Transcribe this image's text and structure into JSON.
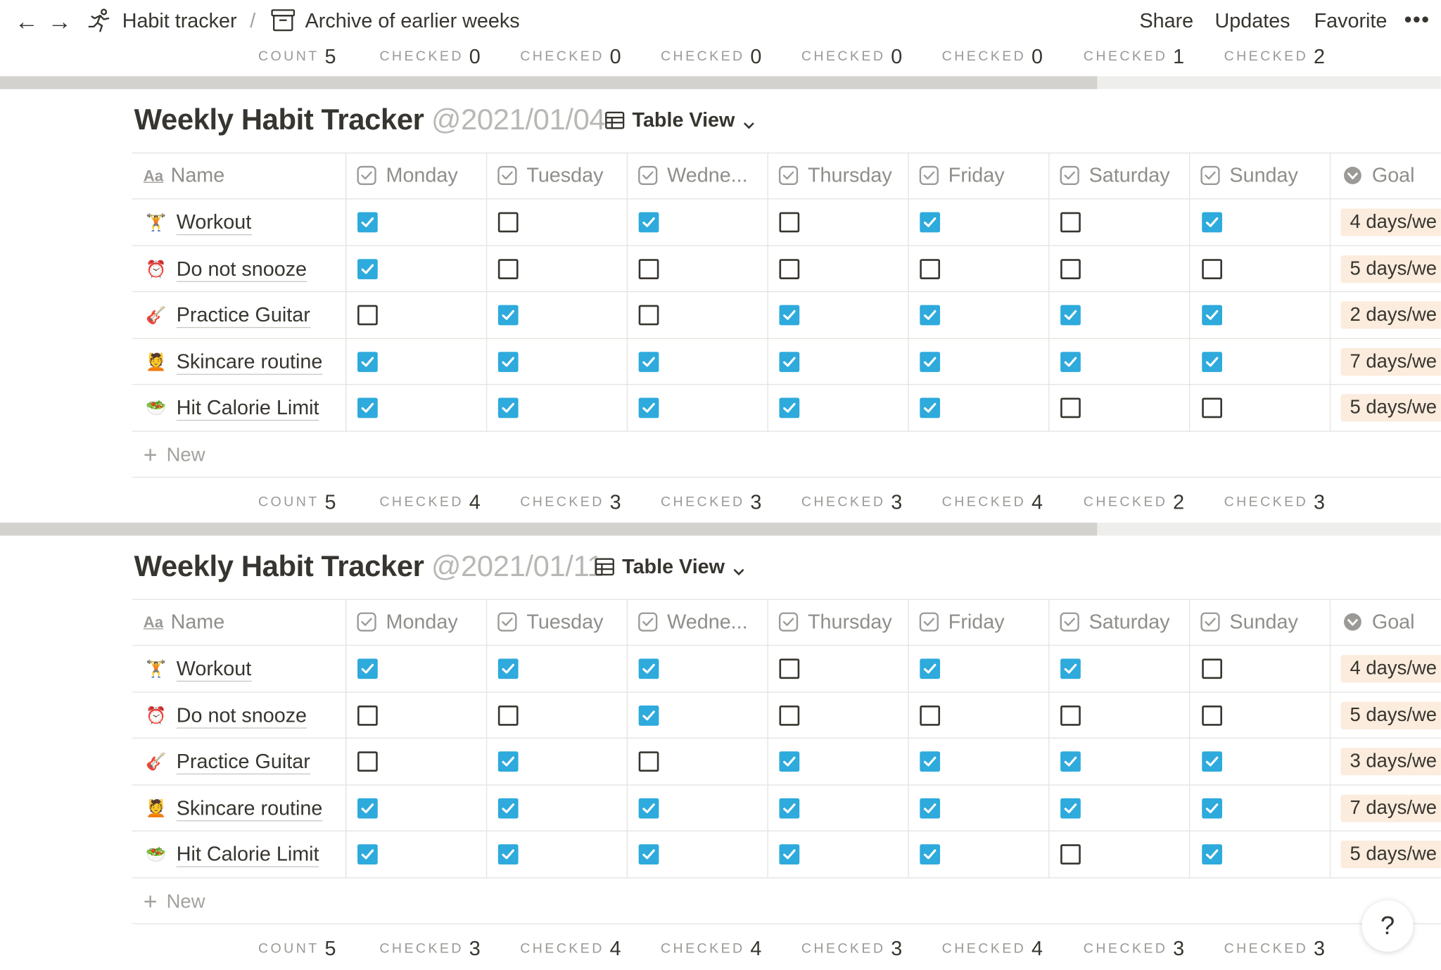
{
  "breadcrumb": {
    "parent": "Habit tracker",
    "separator": "/",
    "current": "Archive of earlier weeks"
  },
  "topbar": {
    "share": "Share",
    "updates": "Updates",
    "favorite": "Favorite",
    "more": "•••"
  },
  "summary_top": {
    "cells": [
      {
        "label": "COUNT",
        "value": "5"
      },
      {
        "label": "CHECKED",
        "value": "0"
      },
      {
        "label": "CHECKED",
        "value": "0"
      },
      {
        "label": "CHECKED",
        "value": "0"
      },
      {
        "label": "CHECKED",
        "value": "0"
      },
      {
        "label": "CHECKED",
        "value": "0"
      },
      {
        "label": "CHECKED",
        "value": "1"
      },
      {
        "label": "CHECKED",
        "value": "2"
      }
    ]
  },
  "columns": {
    "name": "Name",
    "days": [
      "Monday",
      "Tuesday",
      "Wedne...",
      "Thursday",
      "Friday",
      "Saturday",
      "Sunday"
    ],
    "goal": "Goal"
  },
  "trackers": [
    {
      "title": "Weekly Habit Tracker",
      "date": "@2021/01/04",
      "view": "Table View",
      "new_label": "New",
      "rows": [
        {
          "emoji": "🏋",
          "name": "Workout",
          "checks": [
            true,
            false,
            true,
            false,
            true,
            false,
            true
          ],
          "goal": "4 days/we"
        },
        {
          "emoji": "⏰",
          "name": "Do not snooze",
          "checks": [
            true,
            false,
            false,
            false,
            false,
            false,
            false
          ],
          "goal": "5 days/we"
        },
        {
          "emoji": "🎸",
          "name": "Practice Guitar",
          "checks": [
            false,
            true,
            false,
            true,
            true,
            true,
            true
          ],
          "goal": "2 days/we"
        },
        {
          "emoji": "💆",
          "name": "Skincare routine",
          "checks": [
            true,
            true,
            true,
            true,
            true,
            true,
            true
          ],
          "goal": "7 days/we"
        },
        {
          "emoji": "🥗",
          "name": "Hit Calorie Limit",
          "checks": [
            true,
            true,
            true,
            true,
            true,
            false,
            false
          ],
          "goal": "5 days/we"
        }
      ],
      "summary": [
        {
          "label": "COUNT",
          "value": "5"
        },
        {
          "label": "CHECKED",
          "value": "4"
        },
        {
          "label": "CHECKED",
          "value": "3"
        },
        {
          "label": "CHECKED",
          "value": "3"
        },
        {
          "label": "CHECKED",
          "value": "3"
        },
        {
          "label": "CHECKED",
          "value": "4"
        },
        {
          "label": "CHECKED",
          "value": "2"
        },
        {
          "label": "CHECKED",
          "value": "3"
        }
      ]
    },
    {
      "title": "Weekly Habit Tracker",
      "date": "@2021/01/11",
      "view": "Table View",
      "new_label": "New",
      "rows": [
        {
          "emoji": "🏋",
          "name": "Workout",
          "checks": [
            true,
            true,
            true,
            false,
            true,
            true,
            false
          ],
          "goal": "4 days/we"
        },
        {
          "emoji": "⏰",
          "name": "Do not snooze",
          "checks": [
            false,
            false,
            true,
            false,
            false,
            false,
            false
          ],
          "goal": "5 days/we"
        },
        {
          "emoji": "🎸",
          "name": "Practice Guitar",
          "checks": [
            false,
            true,
            false,
            true,
            true,
            true,
            true
          ],
          "goal": "3 days/we"
        },
        {
          "emoji": "💆",
          "name": "Skincare routine",
          "checks": [
            true,
            true,
            true,
            true,
            true,
            true,
            true
          ],
          "goal": "7 days/we"
        },
        {
          "emoji": "🥗",
          "name": "Hit Calorie Limit",
          "checks": [
            true,
            true,
            true,
            true,
            true,
            false,
            true
          ],
          "goal": "5 days/we"
        }
      ],
      "summary": [
        {
          "label": "COUNT",
          "value": "5"
        },
        {
          "label": "CHECKED",
          "value": "3"
        },
        {
          "label": "CHECKED",
          "value": "4"
        },
        {
          "label": "CHECKED",
          "value": "4"
        },
        {
          "label": "CHECKED",
          "value": "3"
        },
        {
          "label": "CHECKED",
          "value": "4"
        },
        {
          "label": "CHECKED",
          "value": "3"
        },
        {
          "label": "CHECKED",
          "value": "3"
        }
      ]
    }
  ],
  "help": "?",
  "colors": {
    "checkbox_on": "#2eaadc",
    "goal_bg": "#fbecdd",
    "text": "#37352f",
    "muted": "#9b9a97"
  }
}
